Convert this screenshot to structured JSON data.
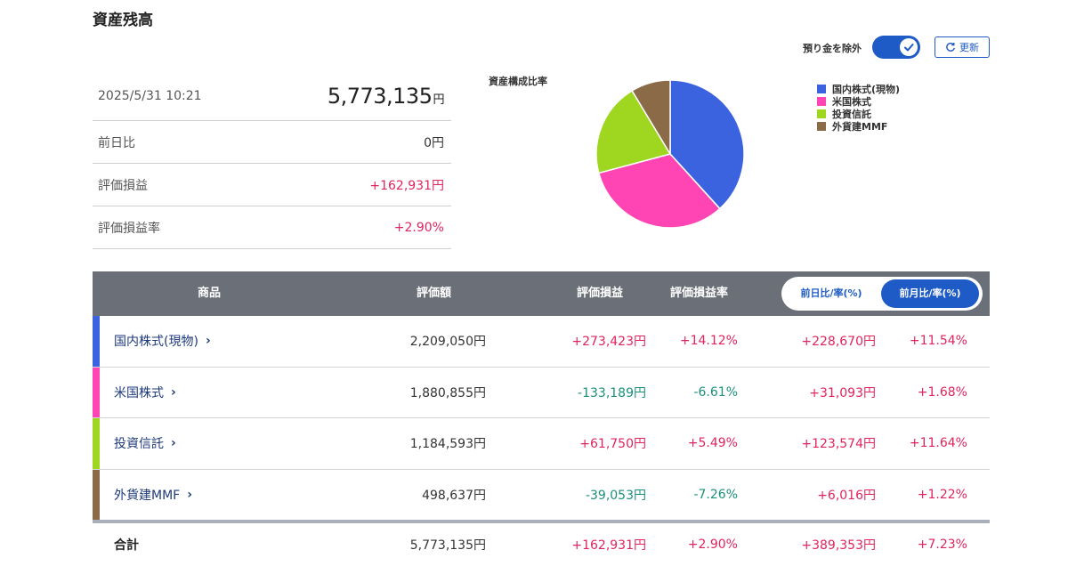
{
  "page_title": "資産残高",
  "summary": {
    "datetime": "2025/5/31 10:21",
    "total_value": "5,773,135",
    "total_unit": "円",
    "rows": [
      {
        "label": "前日比",
        "value": "0円",
        "tone": "neutral"
      },
      {
        "label": "評価損益",
        "value": "+162,931円",
        "tone": "pos"
      },
      {
        "label": "評価損益率",
        "value": "+2.90%",
        "tone": "pos"
      }
    ]
  },
  "chart_title": "資産構成比率",
  "chart_data": {
    "type": "pie",
    "title": "資産構成比率",
    "categories": [
      "国内株式(現物)",
      "米国株式",
      "投資信託",
      "外貨建MMF"
    ],
    "values": [
      2209050,
      1880855,
      1184593,
      498637
    ],
    "colors": [
      "#3b63e0",
      "#ff45b3",
      "#9fd620",
      "#8b6a48"
    ],
    "legend_position": "right"
  },
  "toggle": {
    "label": "預り金を除外",
    "on": true
  },
  "refresh_label": "更新",
  "table": {
    "headers": {
      "product": "商品",
      "amount": "評価額",
      "gain": "評価損益",
      "gain_rate": "評価損益率"
    },
    "segment": {
      "option_a": "前日比/率(%)",
      "option_b": "前月比/率(%)",
      "selected": "前月比/率(%)"
    },
    "rows": [
      {
        "name": "国内株式(現物)",
        "color": "#3b63e0",
        "amount": "2,209,050円",
        "gain": "+273,423円",
        "gain_tone": "pos",
        "rate": "+14.12%",
        "rate_tone": "pos",
        "diff": "+228,670円",
        "diff_tone": "pos",
        "diff_rate": "+11.54%",
        "diff_rate_tone": "pos"
      },
      {
        "name": "米国株式",
        "color": "#ff45b3",
        "amount": "1,880,855円",
        "gain": "-133,189円",
        "gain_tone": "neg",
        "rate": "-6.61%",
        "rate_tone": "neg",
        "diff": "+31,093円",
        "diff_tone": "pos",
        "diff_rate": "+1.68%",
        "diff_rate_tone": "pos"
      },
      {
        "name": "投資信託",
        "color": "#9fd620",
        "amount": "1,184,593円",
        "gain": "+61,750円",
        "gain_tone": "pos",
        "rate": "+5.49%",
        "rate_tone": "pos",
        "diff": "+123,574円",
        "diff_tone": "pos",
        "diff_rate": "+11.64%",
        "diff_rate_tone": "pos"
      },
      {
        "name": "外貨建MMF",
        "color": "#8b6a48",
        "amount": "498,637円",
        "gain": "-39,053円",
        "gain_tone": "neg",
        "rate": "-7.26%",
        "rate_tone": "neg",
        "diff": "+6,016円",
        "diff_tone": "pos",
        "diff_rate": "+1.22%",
        "diff_rate_tone": "pos"
      }
    ],
    "total": {
      "label": "合計",
      "amount": "5,773,135円",
      "gain": "+162,931円",
      "rate": "+2.90%",
      "diff": "+389,353円",
      "diff_rate": "+7.23%"
    }
  },
  "icons": {
    "toggle_check": "check-icon",
    "refresh": "refresh-icon",
    "row_link": "chevron-right-icon"
  }
}
